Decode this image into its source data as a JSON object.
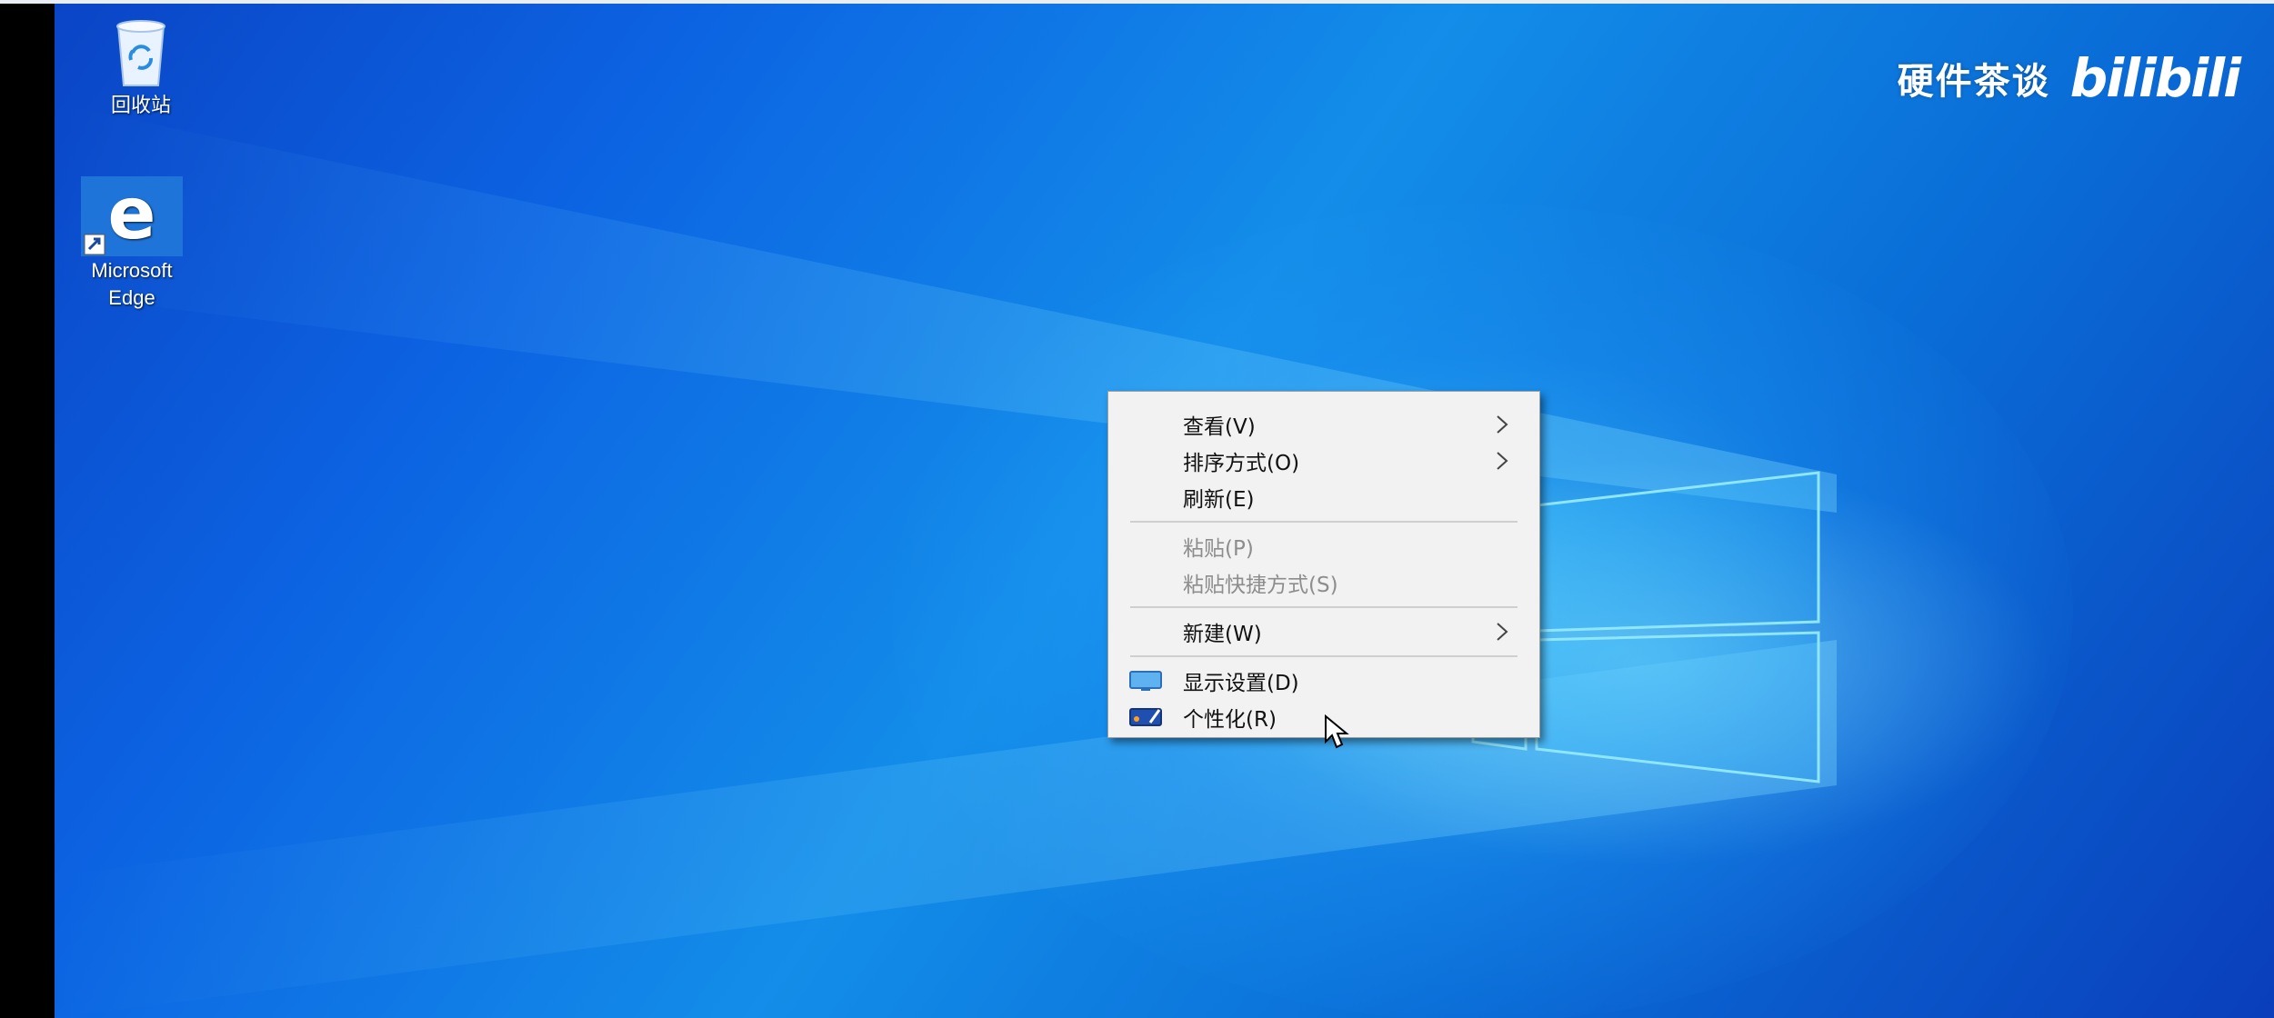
{
  "desktop": {
    "icons": [
      {
        "label": "回收站",
        "icon": "recycle-bin-icon"
      },
      {
        "label_line1": "Microsoft",
        "label_line2": "Edge",
        "icon": "edge-icon"
      }
    ]
  },
  "watermark": {
    "text": "硬件茶谈",
    "logo": "bilibili"
  },
  "context_menu": {
    "items": [
      {
        "label": "查看(V)",
        "submenu": true,
        "enabled": true
      },
      {
        "label": "排序方式(O)",
        "submenu": true,
        "enabled": true
      },
      {
        "label": "刷新(E)",
        "submenu": false,
        "enabled": true
      },
      {
        "label": "粘贴(P)",
        "submenu": false,
        "enabled": false
      },
      {
        "label": "粘贴快捷方式(S)",
        "submenu": false,
        "enabled": false
      },
      {
        "label": "新建(W)",
        "submenu": true,
        "enabled": true
      },
      {
        "label": "显示设置(D)",
        "submenu": false,
        "enabled": true,
        "icon": "display-settings-icon"
      },
      {
        "label": "个性化(R)",
        "submenu": false,
        "enabled": true,
        "icon": "personalize-icon"
      }
    ]
  },
  "colors": {
    "desktop_accent": "#0c63e2",
    "menu_background": "#f2f2f2",
    "disabled_text": "#8d8d8d"
  }
}
